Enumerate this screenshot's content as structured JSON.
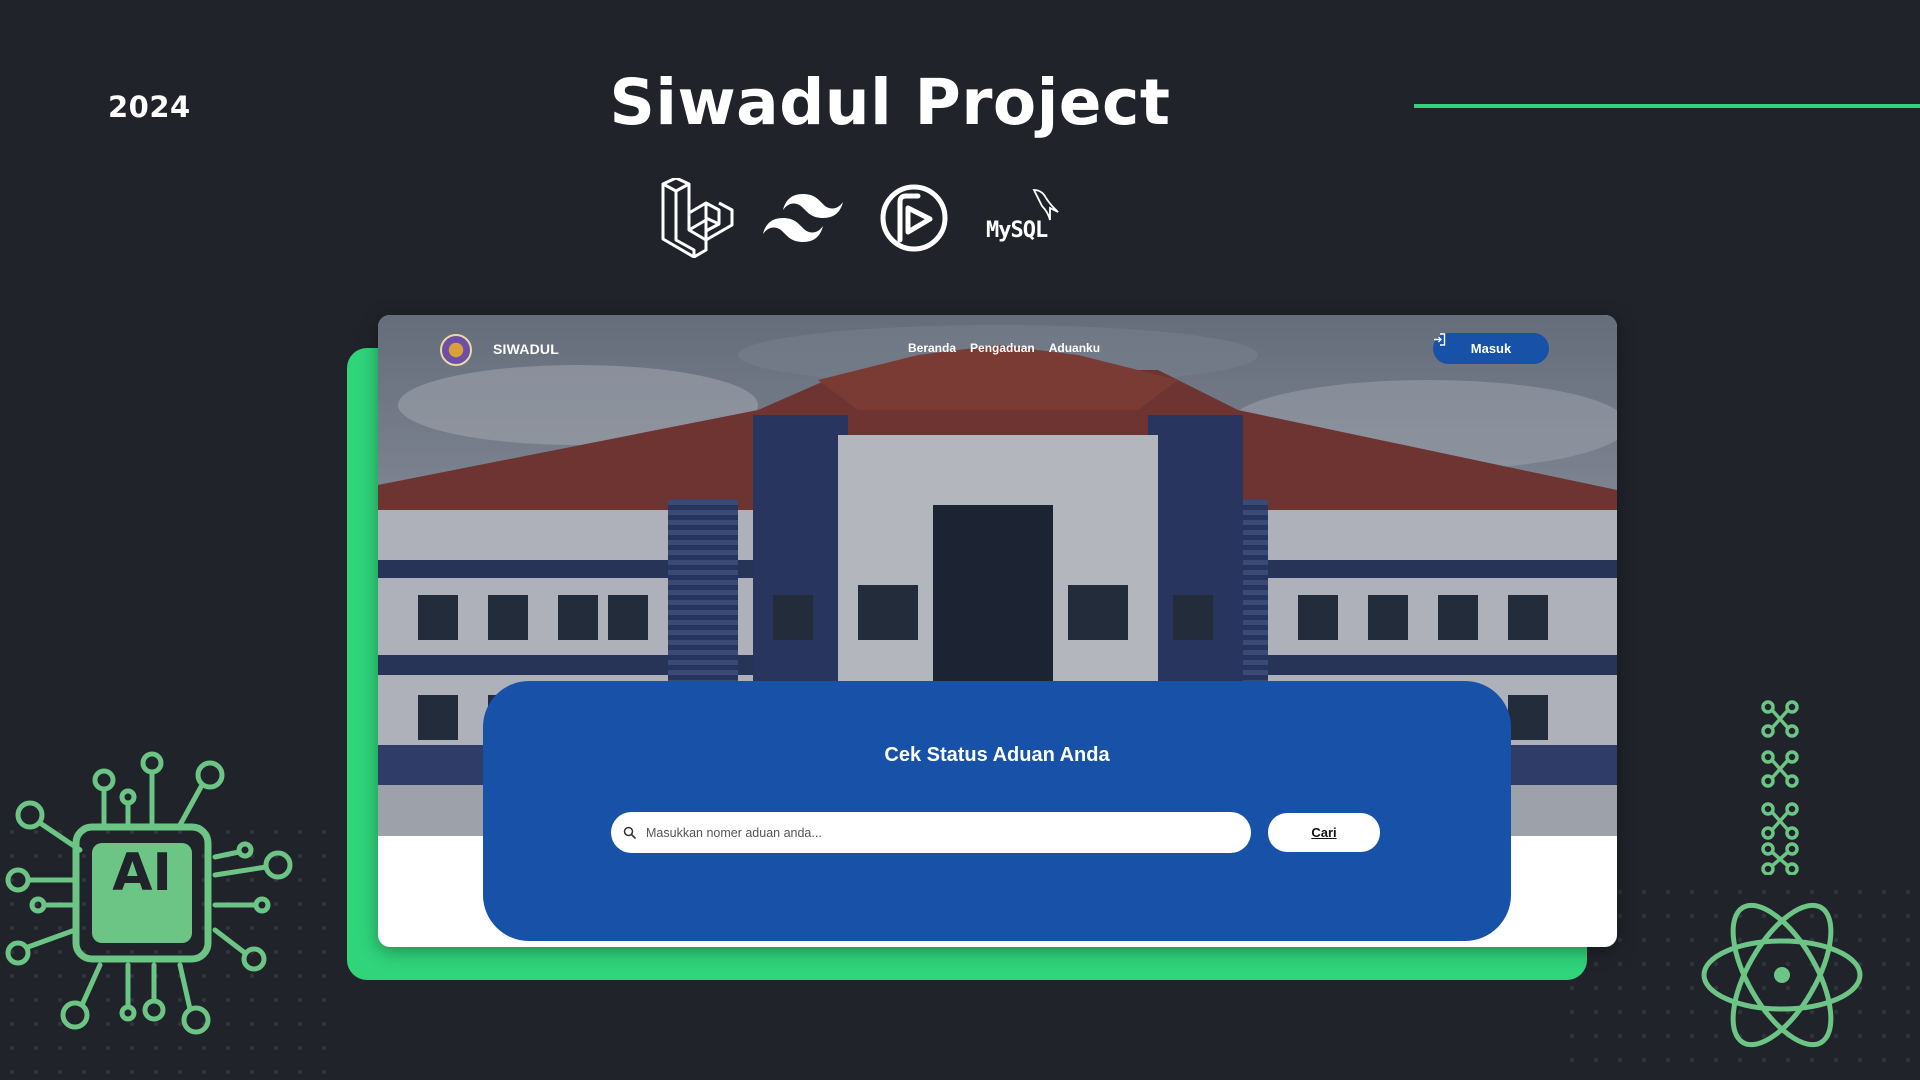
{
  "header": {
    "year": "2024",
    "title": "Siwadul Project",
    "accent_color": "#2fd47b"
  },
  "tech_stack": [
    {
      "name": "laravel-icon"
    },
    {
      "name": "tailwind-icon"
    },
    {
      "name": "filament-icon"
    },
    {
      "name": "mysql-icon",
      "label": "MySQL"
    }
  ],
  "site": {
    "nav": {
      "brand": "SIWADUL",
      "links": [
        "Beranda",
        "Pengaduan",
        "Aduanku"
      ],
      "login_label": "Masuk"
    },
    "search": {
      "title": "Cek Status Aduan Anda",
      "placeholder": "Masukkan nomer aduan anda...",
      "value": "",
      "button_label": "Cari"
    }
  },
  "decor": {
    "ai_chip_label": "AI",
    "ai_color": "#6cc585",
    "card_primary": "#1751a8"
  }
}
